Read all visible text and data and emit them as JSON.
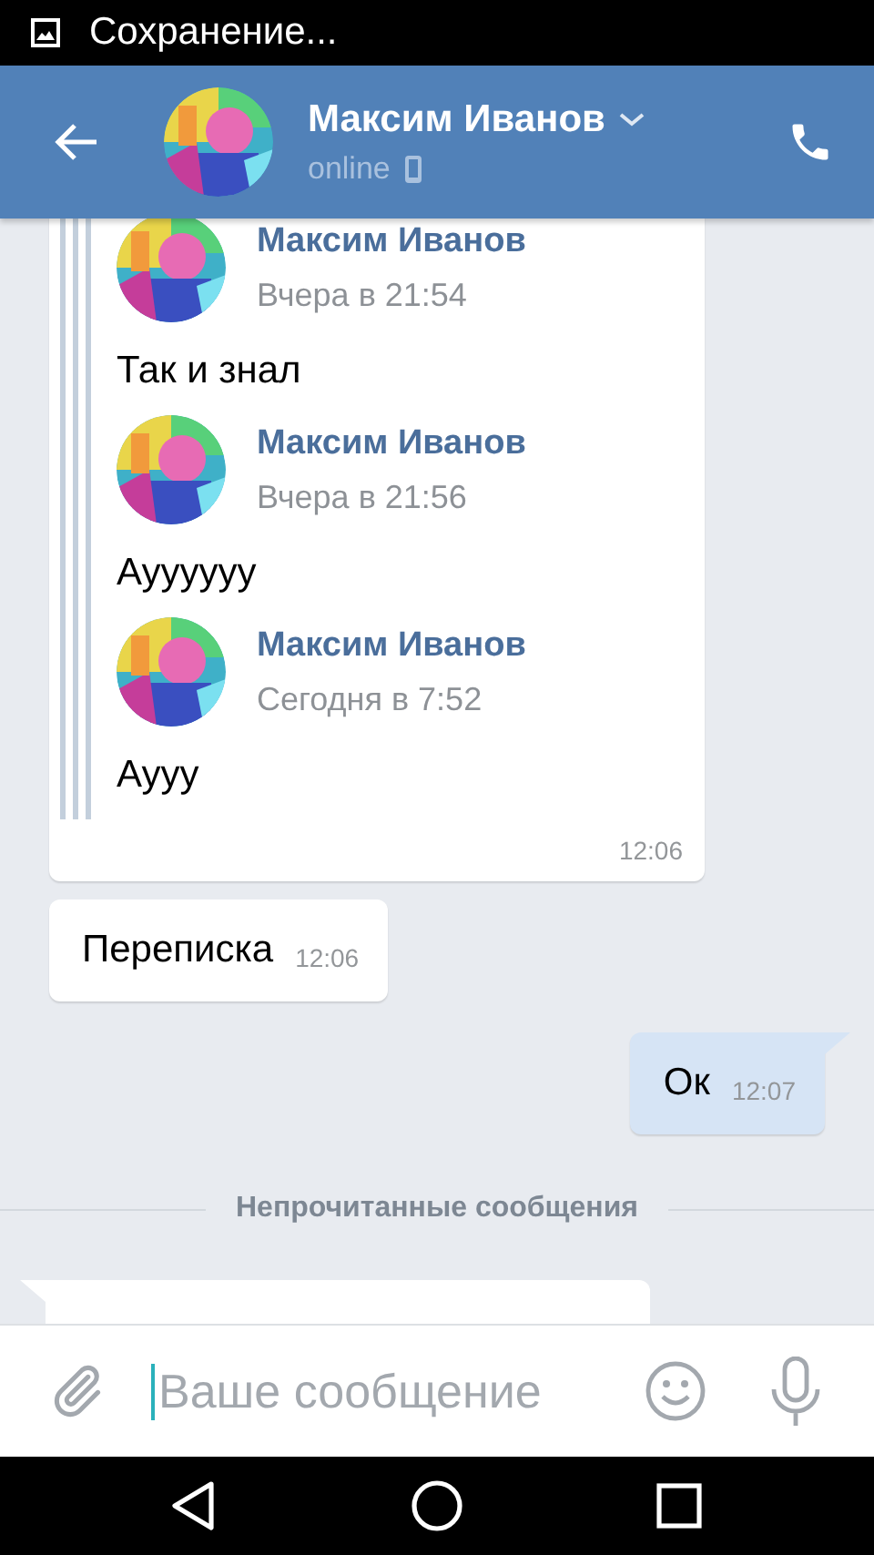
{
  "status_bar": {
    "notification": "Сохранение..."
  },
  "header": {
    "name": "Максим Иванов",
    "status": "online"
  },
  "messages": [
    {
      "kind": "forwarded",
      "time": "12:06",
      "items": [
        {
          "author": "Максим Иванов",
          "time": "Вчера в 21:54",
          "text": "Так и знал"
        },
        {
          "author": "Максим Иванов",
          "time": "Вчера в 21:56",
          "text": "Ауууууу"
        },
        {
          "author": "Максим Иванов",
          "time": "Сегодня в 7:52",
          "text": "Аууу"
        }
      ]
    },
    {
      "kind": "incoming",
      "text": "Переписка",
      "time": "12:06"
    },
    {
      "kind": "outgoing",
      "text": "Ок",
      "time": "12:07"
    },
    {
      "kind": "divider",
      "text": "Непрочитанные сообщения"
    },
    {
      "kind": "partial"
    }
  ],
  "composer": {
    "placeholder": "Ваше сообщение"
  }
}
